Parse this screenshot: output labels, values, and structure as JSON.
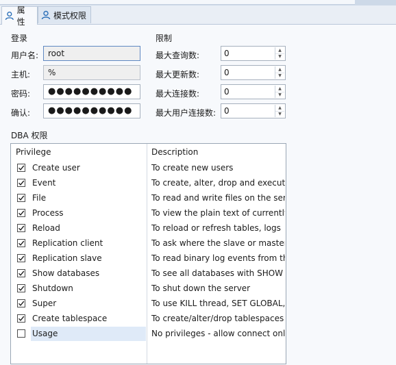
{
  "tabs": [
    {
      "label": "属性",
      "icon": "user-icon"
    },
    {
      "label": "模式权限",
      "icon": "user-icon"
    }
  ],
  "login": {
    "title": "登录",
    "username_label": "用户名:",
    "username_value": "root",
    "host_label": "主机:",
    "host_value": "%",
    "password_label": "密码:",
    "password_value": "●●●●●●●●●●",
    "confirm_label": "确认:",
    "confirm_value": "●●●●●●●●●●"
  },
  "limits": {
    "title": "限制",
    "max_queries_label": "最大查询数:",
    "max_queries_value": "0",
    "max_updates_label": "最大更新数:",
    "max_updates_value": "0",
    "max_connections_label": "最大连接数:",
    "max_connections_value": "0",
    "max_user_connections_label": "最大用户连接数:",
    "max_user_connections_value": "0"
  },
  "dba": {
    "title": "DBA 权限",
    "columns": [
      "Privilege",
      "Description"
    ],
    "rows": [
      {
        "checked": true,
        "privilege": "Create user",
        "description": "To create new users"
      },
      {
        "checked": true,
        "privilege": "Event",
        "description": "To create, alter, drop and execute"
      },
      {
        "checked": true,
        "privilege": "File",
        "description": "To read and write files on the ser"
      },
      {
        "checked": true,
        "privilege": "Process",
        "description": "To view the plain text of currently"
      },
      {
        "checked": true,
        "privilege": "Reload",
        "description": "To reload or refresh tables, logs"
      },
      {
        "checked": true,
        "privilege": "Replication client",
        "description": "To ask where the slave or master"
      },
      {
        "checked": true,
        "privilege": "Replication slave",
        "description": "To read binary log events from th"
      },
      {
        "checked": true,
        "privilege": "Show databases",
        "description": "To see all databases with SHOW I"
      },
      {
        "checked": true,
        "privilege": "Shutdown",
        "description": "To shut down the server"
      },
      {
        "checked": true,
        "privilege": "Super",
        "description": "To use KILL thread, SET GLOBAL,"
      },
      {
        "checked": true,
        "privilege": "Create tablespace",
        "description": "To create/alter/drop tablespaces"
      },
      {
        "checked": false,
        "privilege": "Usage",
        "description": "No privileges - allow connect only"
      }
    ]
  }
}
